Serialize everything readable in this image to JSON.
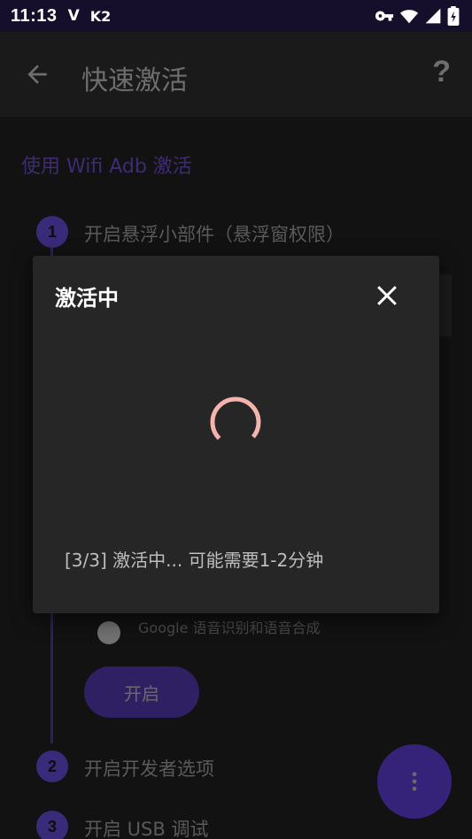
{
  "status_bar": {
    "time": "11:13",
    "indicator_v": "V",
    "indicator_k2": "K2",
    "icons": [
      "vpn-key-icon",
      "wifi-icon",
      "signal-icon",
      "battery-charging-icon"
    ]
  },
  "app_bar": {
    "title": "快速激活",
    "back_icon": "arrow-back-icon",
    "help_label": "?"
  },
  "background": {
    "section_title": "使用 Wifi Adb 激活",
    "steps": [
      {
        "number": "1",
        "label": "开启悬浮小部件（悬浮窗权限）"
      },
      {
        "number": "2",
        "label": "开启开发者选项"
      },
      {
        "number": "3",
        "label": "开启 USB 调试"
      }
    ],
    "row_text": "Google 语音识别和语音合成",
    "open_button_label": "开启",
    "fab_icon": "more-vert-icon"
  },
  "dialog": {
    "title": "激活中",
    "message": "[3/3] 激活中... 可能需要1-2分钟",
    "close_icon": "close-icon"
  },
  "colors": {
    "accent": "#4a34a0",
    "spinner": "#f4b4ab",
    "dialog_bg": "#262626",
    "status_bar": "#160f2c"
  }
}
